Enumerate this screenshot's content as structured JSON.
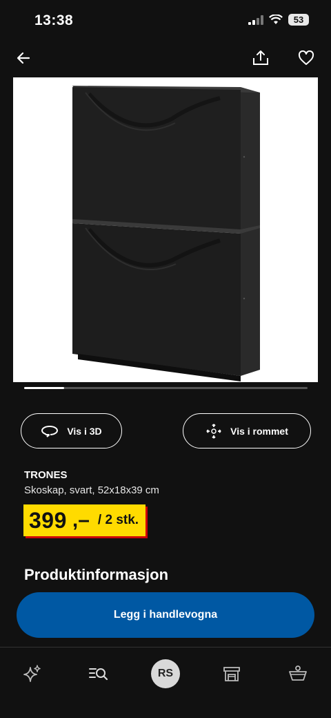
{
  "status_bar": {
    "time": "13:38",
    "battery": "53"
  },
  "header": {
    "back_icon": "arrow-left-icon",
    "share_icon": "share-icon",
    "favorite_icon": "heart-icon"
  },
  "carousel": {
    "progress": 0.14
  },
  "actions": {
    "view_3d_label": "Vis i 3D",
    "view_room_label": "Vis i rommet"
  },
  "product": {
    "name": "TRONES",
    "description": "Skoskap, svart, 52x18x39 cm",
    "price_main": "399",
    "price_decimal": ",–",
    "price_unit": "/ 2 stk."
  },
  "section_title": "Produktinformasjon",
  "cta_label": "Legg i handlevogna",
  "tabbar": {
    "avatar_initials": "RS"
  },
  "colors": {
    "background": "#111111",
    "price_tag": "#ffdb00",
    "price_shadow": "#cc0008",
    "cta": "#0058a3"
  }
}
